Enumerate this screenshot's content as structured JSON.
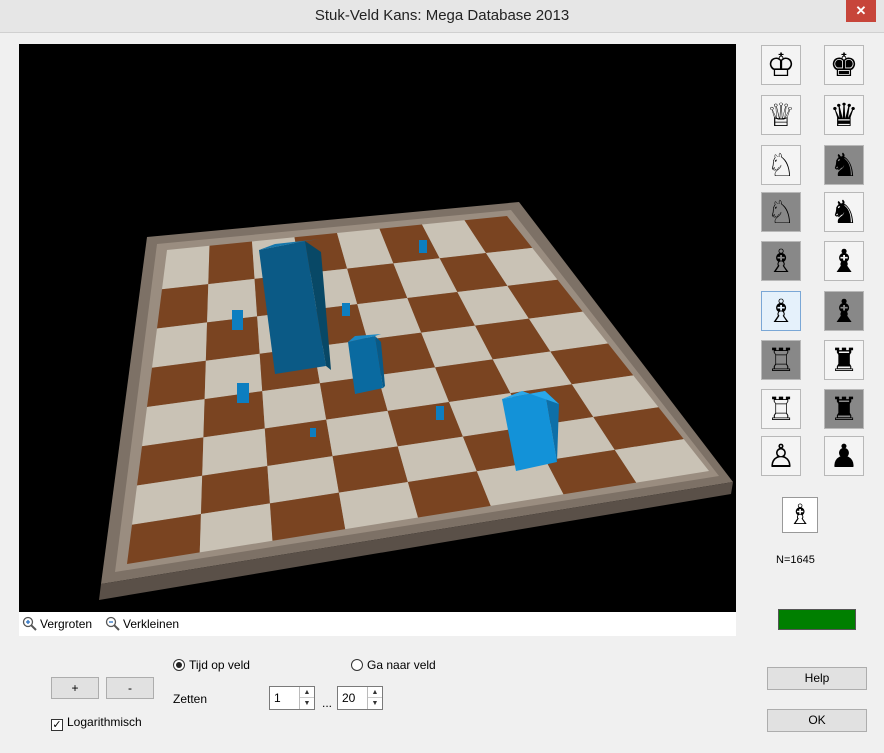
{
  "window": {
    "title": "Stuk-Veld Kans: Mega Database 2013",
    "close_glyph": "✕"
  },
  "zoom": {
    "in_label": "Vergroten",
    "out_label": "Verkleinen"
  },
  "pieces": {
    "white_column": [
      "♔",
      "♕",
      "♘",
      "♘",
      "♗",
      "♗",
      "♖",
      "♖",
      "♙"
    ],
    "black_column": [
      "♚",
      "♛",
      "♞",
      "♞",
      "♝",
      "♝",
      "♜",
      "♜",
      "♟"
    ]
  },
  "selected_piece": "♗",
  "count_label": "N=1645",
  "status_color": "#007f00",
  "controls": {
    "plus_label": "+",
    "minus_label": "-",
    "radio_time": "Tijd op veld",
    "radio_goto": "Ga naar veld",
    "moves_label": "Zetten",
    "from_value": "1",
    "range_sep": "...",
    "to_value": "20",
    "log_label": "Logarithmisch",
    "check_glyph": "✓"
  },
  "buttons": {
    "help": "Help",
    "ok": "OK"
  }
}
